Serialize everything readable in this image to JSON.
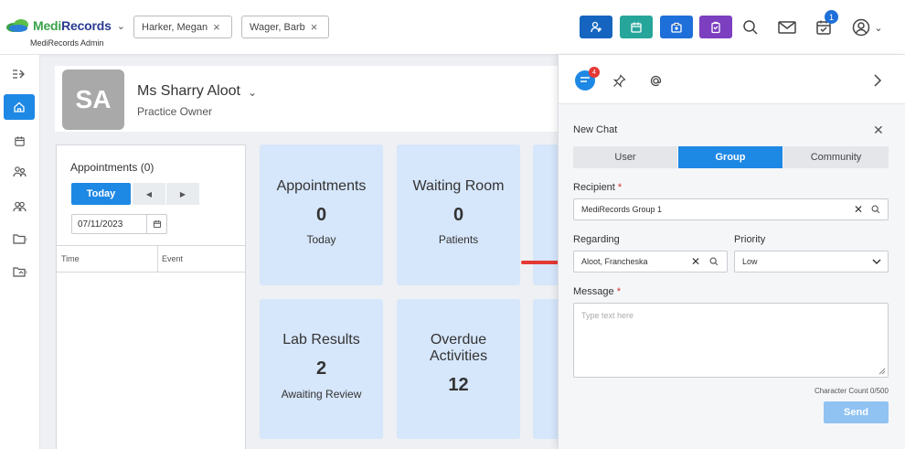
{
  "app": {
    "name_part1": "Medi",
    "name_part2": "Records",
    "subtitle": "MediRecords Admin"
  },
  "patient_tabs": [
    {
      "label": "Harker, Megan"
    },
    {
      "label": "Wager, Barb"
    }
  ],
  "toolbar": {
    "notifications_count": "1",
    "colors": {
      "blue": "#1565c0",
      "teal": "#26a69a",
      "blue2": "#1e6fd9",
      "purple": "#7b3fbf"
    }
  },
  "profile": {
    "initials": "SA",
    "name": "Ms Sharry Aloot",
    "role": "Practice Owner"
  },
  "appointments": {
    "title": "Appointments (0)",
    "today_label": "Today",
    "prev_label": "◀",
    "next_label": "▶",
    "date": "07/11/2023",
    "columns": [
      "Time",
      "Event"
    ]
  },
  "tiles": [
    {
      "title": "Appointments",
      "value": "0",
      "sub": "Today"
    },
    {
      "title": "Waiting Room",
      "value": "0",
      "sub": "Patients"
    },
    {
      "title": "Lab Results",
      "value": "2",
      "sub": "Awaiting Review"
    },
    {
      "title_line1": "Overdue",
      "title_line2": "Activities",
      "value": "12"
    }
  ],
  "chat": {
    "unread_count": "4",
    "new_chat_title": "New Chat",
    "tabs": [
      {
        "label": "User",
        "active": false
      },
      {
        "label": "Group",
        "active": true
      },
      {
        "label": "Community",
        "active": false
      }
    ],
    "recipient_label": "Recipient",
    "recipient_value": "MediRecords Group 1",
    "regarding_label": "Regarding",
    "regarding_value": "Aloot, Francheska",
    "priority_label": "Priority",
    "priority_value": "Low",
    "message_label": "Message",
    "message_placeholder": "Type text here",
    "char_count": "Character Count 0/500",
    "send_label": "Send"
  }
}
